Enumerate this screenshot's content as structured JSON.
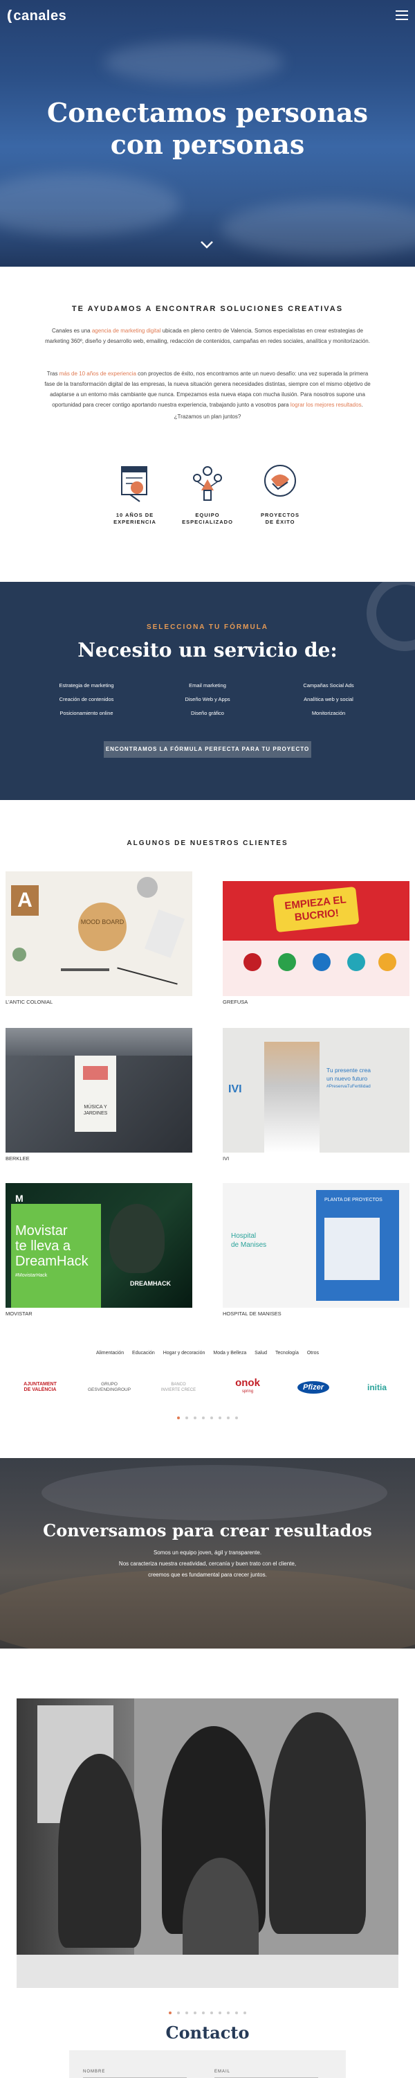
{
  "header": {
    "logo_text": "canales",
    "menu_icon": "hamburger-icon"
  },
  "hero": {
    "title_line1": "Conectamos personas",
    "title_line2": "con personas",
    "scroll_icon": "chevron-down-icon"
  },
  "intro": {
    "heading": "TE AYUDAMOS A ENCONTRAR SOLUCIONES CREATIVAS",
    "p1_a": "Canales es una ",
    "p1_link": "agencia de marketing digital",
    "p1_b": " ubicada en pleno centro de Valencia. Somos especialistas en crear estrategias de marketing 360º, diseño y desarrollo web, emailing, redacción de contenidos, campañas en redes sociales, analítica y monitorización.",
    "p2_a": "Tras ",
    "p2_link1": "más de 10 años de experiencia",
    "p2_b": " con proyectos de éxito, nos encontramos ante un nuevo desafío: una vez superada la primera fase de la transformación digital de las empresas, la nueva situación genera necesidades distintas, siempre con el mismo objetivo de adaptarse a un entorno más cambiante que nunca. Empezamos esta nueva etapa con mucha ilusión. Para nosotros supone una oportunidad para crecer contigo aportando nuestra experiencia, trabajando junto a vosotros para ",
    "p2_link2": "lograr los mejores resultados",
    "p2_c": ".",
    "p3": "¿Trazamos un plan juntos?",
    "stats": [
      {
        "label_1": "10 AÑOS DE",
        "label_2": "EXPERIENCIA",
        "icon": "calendar-icon"
      },
      {
        "label_1": "EQUIPO",
        "label_2": "ESPECIALIZADO",
        "icon": "team-icon"
      },
      {
        "label_1": "PROYECTOS",
        "label_2": "DE ÉXITO",
        "icon": "handshake-icon"
      }
    ]
  },
  "service": {
    "kicker": "SELECCIONA TU FÓRMULA",
    "title": "Necesito un servicio de:",
    "options": [
      "Estrategia de marketing",
      "Email marketing",
      "Campañas Social Ads",
      "Creación de contenidos",
      "Diseño Web y Apps",
      "Analítica web y social",
      "Posicionamiento online",
      "Diseño gráfico",
      "Monitorización"
    ],
    "cta": "ENCONTRAMOS LA FÓRMULA PERFECTA PARA TU PROYECTO"
  },
  "clients": {
    "heading": "ALGUNOS DE NUESTROS CLIENTES",
    "cards": [
      {
        "caption": "L'ANTIC COLONIAL",
        "mood_text": "MOOD BOARD",
        "letter": "A"
      },
      {
        "caption": "GREFUSA",
        "headline": "EMPIEZA EL BUCRIO!"
      },
      {
        "caption": "BERKLEE",
        "poster_text": "MÚSICA Y JARDINES"
      },
      {
        "caption": "IVI",
        "logo": "IVI",
        "slogan_1": "Tu presente crea",
        "slogan_2": "un nuevo futuro",
        "hashtag": "#PreservaTuFertilidad"
      },
      {
        "caption": "MOVISTAR",
        "line1": "Movistar",
        "line2": "te lleva a",
        "line3": "DreamHack",
        "tag": "#MovistarHack",
        "brand": "DREAMHACK"
      },
      {
        "caption": "HOSPITAL DE MANISES",
        "logo_1": "Hospital",
        "logo_2": "de Manises",
        "book": "PLANTA DE PROYECTOS"
      }
    ],
    "filters": [
      "Alimentación",
      "Educación",
      "Hogar y decoración",
      "Moda y Belleza",
      "Salud",
      "Tecnología",
      "Otros"
    ],
    "logos": [
      {
        "text_1": "AJUNTAMENT",
        "text_2": "DE VALÈNCIA"
      },
      {
        "text_1": "GRUPO",
        "text_2": "GESVENDINGROUP"
      },
      {
        "text_1": "BANCO",
        "text_2": "INVIERTE CRECE"
      },
      {
        "text_1": "onok",
        "text_2": "spring"
      },
      {
        "text_1": "Pfizer",
        "text_2": ""
      },
      {
        "text_1": "initia",
        "text_2": ""
      }
    ]
  },
  "conversamos": {
    "title": "Conversamos para crear resultados",
    "line1": "Somos un equipo joven, ágil y transparente.",
    "line2": "Nos caracteriza nuestra creatividad, cercanía y buen trato con el cliente,",
    "line3": "creemos que es fundamental para crecer juntos."
  },
  "contact": {
    "title": "Contacto",
    "name_label": "NOMBRE",
    "email_label": "EMAIL"
  }
}
